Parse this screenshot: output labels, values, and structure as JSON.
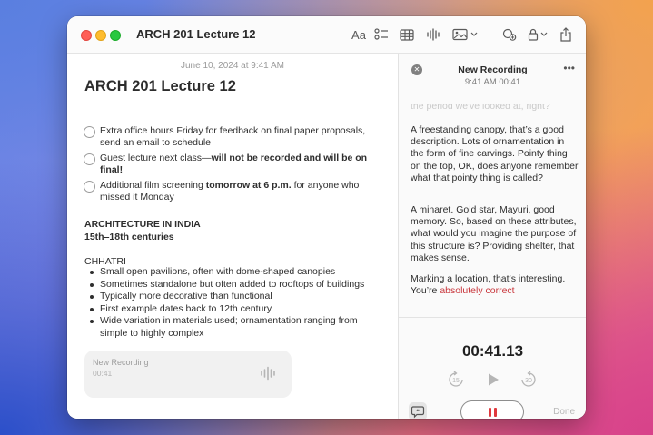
{
  "window": {
    "title": "ARCH 201 Lecture 12"
  },
  "toolbar": {
    "format_label": "Aa",
    "icons": [
      "format-text-icon",
      "checklist-icon",
      "table-icon",
      "audio-waveform-icon",
      "media-icon",
      "collaborate-icon",
      "lock-icon",
      "share-icon"
    ]
  },
  "note": {
    "date": "June 10, 2024 at 9:41 AM",
    "title": "ARCH 201 Lecture 12",
    "checklist": [
      {
        "text_before": "Extra office hours Friday for feedback on final paper proposals, send an email to schedule",
        "bold": "",
        "text_after": ""
      },
      {
        "text_before": "Guest lecture next class—",
        "bold": "will not be recorded and will be on final!",
        "text_after": ""
      },
      {
        "text_before": "Additional film screening ",
        "bold": "tomorrow at 6 p.m.",
        "text_after": " for anyone who missed it Monday"
      }
    ],
    "section_heading": "ARCHITECTURE IN INDIA",
    "section_subheading": "15th–18th centuries",
    "subsection": "CHHATRI",
    "bullets": [
      "Small open pavilions, often with dome-shaped canopies",
      "Sometimes standalone but often added to rooftops of buildings",
      "Typically more decorative than functional",
      "First example dates back to 12th century",
      "Wide variation in materials used; ornamentation ranging from simple to highly complex"
    ],
    "recording_card": {
      "title": "New Recording",
      "time": "00:41"
    }
  },
  "panel": {
    "title": "New Recording",
    "subtitle": "9:41 AM  00:41",
    "transcript_faded": "the period we've looked at, right?",
    "paragraphs": [
      {
        "text": "A freestanding canopy, that’s a good description. Lots of ornamentation in the form of fine carvings. Pointy thing on the top, OK, does anyone remember what that pointy thing is called?",
        "highlight": ""
      },
      {
        "text": "A minaret. Gold star, Mayuri, good memory. So, based on these attributes, what would you imagine the purpose of this structure is? Providing shelter, that makes sense.",
        "highlight": ""
      },
      {
        "text": "Marking a location, that’s interesting. You’re ",
        "highlight": "absolutely correct"
      }
    ],
    "timer": "00:41.13",
    "skip_back_label": "15",
    "skip_forward_label": "30",
    "done_label": "Done",
    "accent_color": "#e0393e"
  }
}
